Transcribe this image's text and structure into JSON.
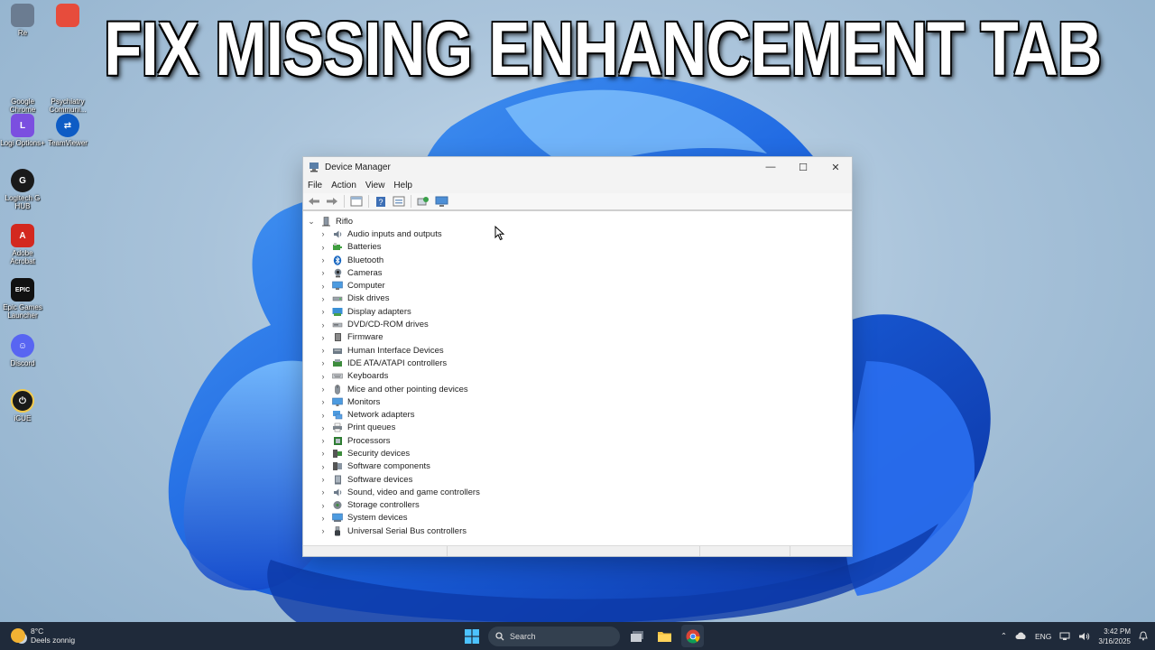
{
  "overlay_title": "FIX MISSING ENHANCEMENT TAB",
  "desktop_icons": [
    {
      "label": "Re",
      "color": "#6b7c91",
      "glyph": ""
    },
    {
      "label": "",
      "color": "#e74c3c",
      "glyph": ""
    },
    {
      "label": "Google Chrome",
      "color": "#2b6fd6",
      "glyph": ""
    },
    {
      "label": "Psychiatry Communi...",
      "color": "#3b4a5c",
      "glyph": ""
    },
    {
      "label": "Logi Options+",
      "color": "#7b4fe0",
      "glyph": "L"
    },
    {
      "label": "TeamViewer",
      "color": "#0e5cc5",
      "glyph": "TV"
    },
    {
      "label": "Logitech G HUB",
      "color": "#1a1a1a",
      "glyph": "G"
    },
    {
      "label": "Adobe Acrobat",
      "color": "#d3281f",
      "glyph": "A"
    },
    {
      "label": "Epic Games Launcher",
      "color": "#111111",
      "glyph": "EPIC"
    },
    {
      "label": "Discord",
      "color": "#5865f2",
      "glyph": "D"
    },
    {
      "label": "iCUE",
      "color": "#1a1a1a",
      "glyph": "⏻"
    }
  ],
  "window": {
    "title": "Device Manager",
    "controls": {
      "minimize": "—",
      "maximize": "☐",
      "close": "✕"
    },
    "menu": [
      "File",
      "Action",
      "View",
      "Help"
    ],
    "root": "Riflo",
    "devices": [
      {
        "label": "Audio inputs and outputs",
        "icon": "speaker-icon"
      },
      {
        "label": "Batteries",
        "icon": "battery-icon"
      },
      {
        "label": "Bluetooth",
        "icon": "bluetooth-icon"
      },
      {
        "label": "Cameras",
        "icon": "camera-icon"
      },
      {
        "label": "Computer",
        "icon": "computer-icon"
      },
      {
        "label": "Disk drives",
        "icon": "disk-icon"
      },
      {
        "label": "Display adapters",
        "icon": "display-adapter-icon"
      },
      {
        "label": "DVD/CD-ROM drives",
        "icon": "dvd-icon"
      },
      {
        "label": "Firmware",
        "icon": "firmware-icon"
      },
      {
        "label": "Human Interface Devices",
        "icon": "hid-icon"
      },
      {
        "label": "IDE ATA/ATAPI controllers",
        "icon": "ide-controller-icon"
      },
      {
        "label": "Keyboards",
        "icon": "keyboard-icon"
      },
      {
        "label": "Mice and other pointing devices",
        "icon": "mouse-icon"
      },
      {
        "label": "Monitors",
        "icon": "monitor-icon"
      },
      {
        "label": "Network adapters",
        "icon": "network-icon"
      },
      {
        "label": "Print queues",
        "icon": "printer-icon"
      },
      {
        "label": "Processors",
        "icon": "processor-icon"
      },
      {
        "label": "Security devices",
        "icon": "security-icon"
      },
      {
        "label": "Software components",
        "icon": "software-component-icon"
      },
      {
        "label": "Software devices",
        "icon": "software-device-icon"
      },
      {
        "label": "Sound, video and game controllers",
        "icon": "sound-icon"
      },
      {
        "label": "Storage controllers",
        "icon": "storage-icon"
      },
      {
        "label": "System devices",
        "icon": "system-icon"
      },
      {
        "label": "Universal Serial Bus controllers",
        "icon": "usb-icon"
      }
    ]
  },
  "taskbar": {
    "weather_temp": "8°C",
    "weather_desc": "Deels zonnig",
    "search_placeholder": "Search",
    "language": "ENG",
    "time": "3:42 PM",
    "date": "3/16/2025"
  },
  "colors": {
    "accent": "#1f6fd6",
    "taskbar_bg": "#1f2a3a",
    "window_bg": "#ffffff"
  }
}
